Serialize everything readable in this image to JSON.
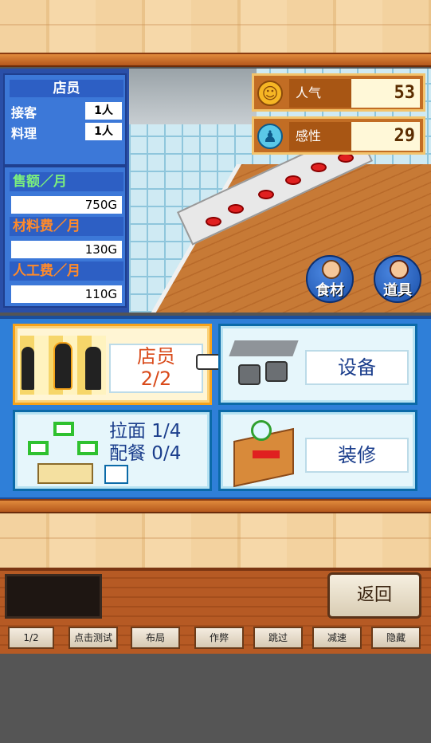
{
  "staff_panel": {
    "title": "店员",
    "rows": [
      {
        "label": "接客",
        "value": "1人"
      },
      {
        "label": "料理",
        "value": "1人"
      }
    ],
    "money": [
      {
        "label": "售额／月",
        "value": "750G",
        "color": "#7cf07c"
      },
      {
        "label": "材料费／月",
        "value": "130G",
        "color": "#ff8a2a"
      },
      {
        "label": "人工费／月",
        "value": "110G",
        "color": "#ff8a2a"
      }
    ]
  },
  "stats": [
    {
      "label": "人气",
      "value": "53",
      "icon": "smile-icon"
    },
    {
      "label": "感性",
      "value": "29",
      "icon": "person-icon"
    }
  ],
  "scene_buttons": {
    "ingredients": "食材",
    "items": "道具"
  },
  "menu": {
    "staff": {
      "label_line1": "店员",
      "label_line2": "2/2"
    },
    "equipment": {
      "label": "设备"
    },
    "menu_items": {
      "line1": "拉面 1/4",
      "line2": "配餐 0/4"
    },
    "decor": {
      "label": "装修"
    }
  },
  "bottom": {
    "back_label": "返回",
    "debug_buttons": [
      "1/2",
      "点击测试",
      "布局",
      "作弊",
      "跳过",
      "减速",
      "隐藏"
    ]
  },
  "colors": {
    "accent_blue": "#2f7fd8",
    "selected_orange": "#f7a21a",
    "stat_orange": "#c26d24"
  }
}
